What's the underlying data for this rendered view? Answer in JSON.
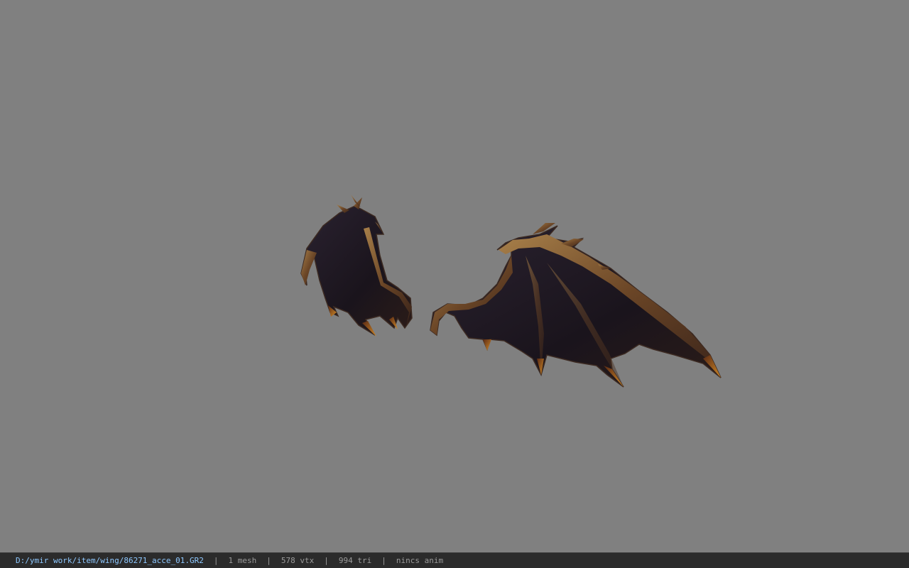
{
  "viewport": {
    "background_color": "#808080",
    "model": "wing mesh (pair of dark bat-like wings)"
  },
  "status_bar": {
    "file_path": "D:/ymir work/item/wing/86271_acce_01.GR2",
    "separator": "|",
    "mesh_count": "1 mesh",
    "vertex_count": "578 vtx",
    "triangle_count": "994 tri",
    "anim_status": "nincs anim"
  },
  "colors": {
    "path_text": "#8ec8ff",
    "stat_text": "#9a9a9a",
    "bar_background": "#2b2b2b"
  }
}
